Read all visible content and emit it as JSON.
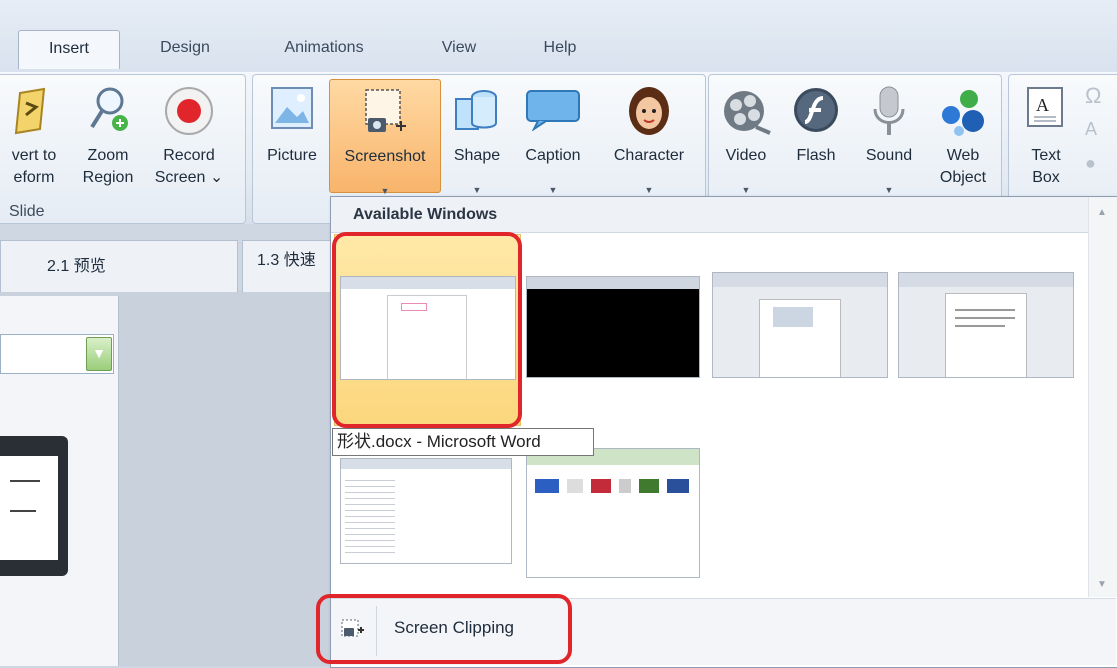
{
  "tabs": [
    {
      "label": "Insert",
      "active": true
    },
    {
      "label": "Design",
      "active": false
    },
    {
      "label": "Animations",
      "active": false
    },
    {
      "label": "View",
      "active": false
    },
    {
      "label": "Help",
      "active": false
    }
  ],
  "ribbon": {
    "slide_group": {
      "label": "Slide",
      "convert": {
        "line1": "vert to",
        "line2": "eform"
      },
      "zoom": {
        "line1": "Zoom",
        "line2": "Region"
      },
      "record": {
        "line1": "Record",
        "line2": "Screen ⌄"
      }
    },
    "picture": "Picture",
    "screenshot": "Screenshot",
    "shape": "Shape",
    "caption": "Caption",
    "character": "Character",
    "video": "Video",
    "flash": "Flash",
    "sound": "Sound",
    "web_object": {
      "line1": "Web",
      "line2": "Object"
    },
    "text_box": {
      "line1": "Text",
      "line2": "Box"
    }
  },
  "doc_tabs": [
    "2.1 预览",
    "1.3 快速"
  ],
  "dropdown": {
    "header": "Available Windows",
    "tooltip": "形状.docx - Microsoft Word",
    "screen_clipping": "Screen Clipping"
  },
  "colors": {
    "highlight_red": "#e1262b",
    "selected_orange": "#f8b46b",
    "ribbon_bg": "#e3eaf3"
  }
}
